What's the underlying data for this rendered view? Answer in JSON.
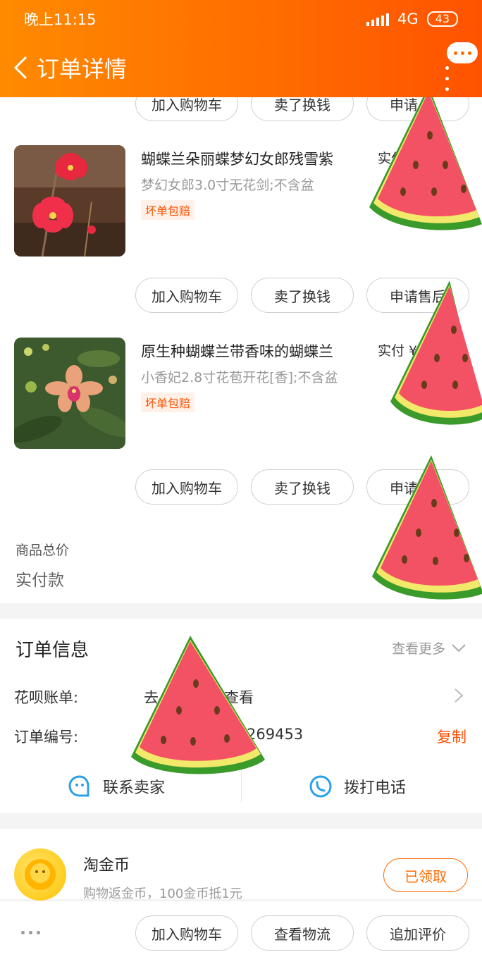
{
  "status_bar": {
    "time": "晚上11:15",
    "network": "4G",
    "battery": "43"
  },
  "header": {
    "title": "订单详情"
  },
  "goods": {
    "action_labels": {
      "add_cart": "加入购物车",
      "resell": "卖了换钱",
      "after_sale": "申请售后"
    },
    "top_row": {
      "after_sale_visible": "申请"
    },
    "items": [
      {
        "title": "蝴蝶兰朵丽蝶梦幻女郎残雪紫",
        "spec": "梦幻女郎3.0寸无花剑;不含盆",
        "badge": "坏单包赔",
        "paid": "实付"
      },
      {
        "title": "原生种蝴蝶兰带香味的蝴蝶兰",
        "spec": "小香妃2.8寸花苞开花[香];不含盆",
        "badge": "坏单包赔",
        "paid": "实付 ¥"
      }
    ],
    "total_label": "商品总价",
    "paid_label": "实付款"
  },
  "order_info": {
    "title": "订单信息",
    "view_more": "查看更多",
    "huabei_label": "花呗账单:",
    "huabei_value_left": "去",
    "huabei_value_right": "查看",
    "order_no_label": "订单编号:",
    "order_no_value": "269453",
    "copy": "复制",
    "contact_seller": "联系卖家",
    "call_phone": "拨打电话"
  },
  "coin": {
    "title": "淘金币",
    "subtitle": "购物返金币，100金币抵1元",
    "button": "已领取"
  },
  "bottom_bar": {
    "add_cart": "加入购物车",
    "logistics": "查看物流",
    "review": "追加评价"
  },
  "colors": {
    "brand": "#ff6a00",
    "accent_text": "#ff5000"
  }
}
